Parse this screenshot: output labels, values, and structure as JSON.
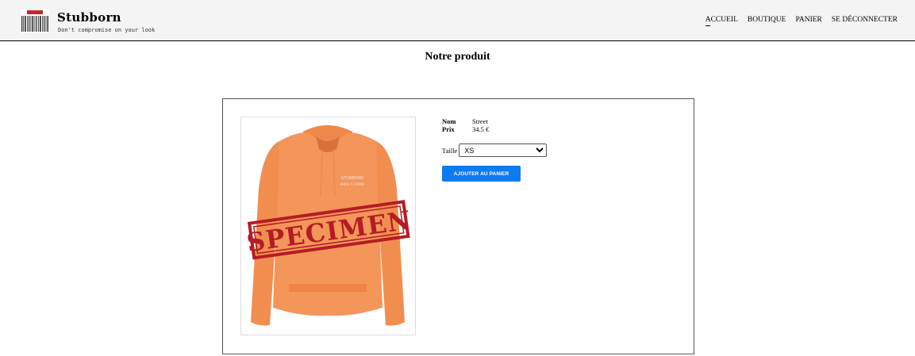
{
  "header": {
    "brand_name": "Stubborn",
    "tagline": "Don't compromise on your look",
    "nav": [
      {
        "label": "ACCUEIL",
        "active": true
      },
      {
        "label": "BOUTIQUE",
        "active": false
      },
      {
        "label": "PANIER",
        "active": false
      },
      {
        "label": "SE DÉCONNECTER",
        "active": false
      }
    ]
  },
  "page": {
    "title": "Notre produit"
  },
  "product": {
    "name_label": "Nom",
    "name_value": "Street",
    "price_label": "Prix",
    "price_value": "34.5 €",
    "size_label": "Taille",
    "size_selected": "XS",
    "add_button_label": "AJOUTER AU PANIER",
    "image_watermark": "SPECIMEN",
    "image_color": "#f4955a"
  }
}
